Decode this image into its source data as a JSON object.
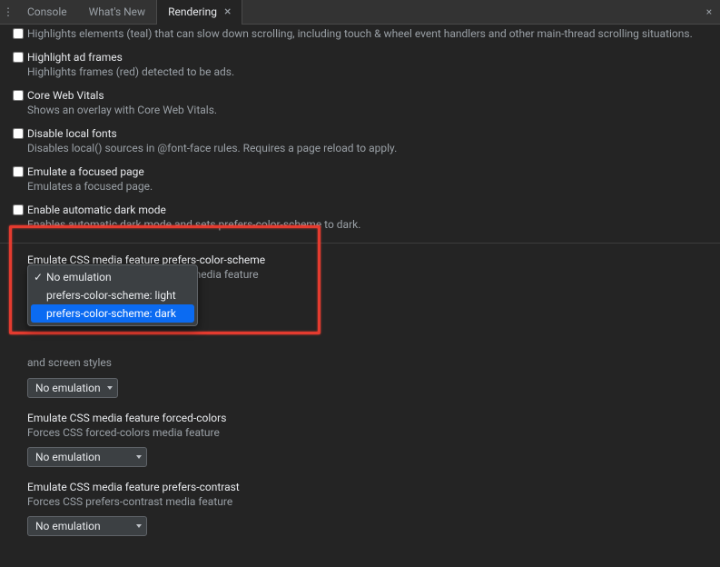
{
  "tabs": {
    "console": "Console",
    "whatsnew": "What's New",
    "rendering": "Rendering"
  },
  "rows": {
    "r0": {
      "tail": "Highlights elements (teal) that can slow down scrolling, including touch & wheel event handlers and other main-thread scrolling situations."
    },
    "r1": {
      "t": "Highlight ad frames",
      "d": "Highlights frames (red) detected to be ads."
    },
    "r2": {
      "t": "Core Web Vitals",
      "d": "Shows an overlay with Core Web Vitals."
    },
    "r3": {
      "t": "Disable local fonts",
      "d": "Disables local() sources in @font-face rules. Requires a page reload to apply."
    },
    "r4": {
      "t": "Emulate a focused page",
      "d": "Emulates a focused page."
    },
    "r5": {
      "t": "Enable automatic dark mode",
      "d": "Enables automatic dark mode and sets prefers-color-scheme to dark."
    }
  },
  "sections": {
    "s1": {
      "t": "Emulate CSS media feature prefers-color-scheme",
      "d": "Forces CSS prefers-color-scheme media feature"
    },
    "s2_trail": "and screen styles",
    "s2_sel": "No emulation",
    "s3": {
      "t": "Emulate CSS media feature forced-colors",
      "d": "Forces CSS forced-colors media feature",
      "sel": "No emulation"
    },
    "s4": {
      "t": "Emulate CSS media feature prefers-contrast",
      "d": "Forces CSS prefers-contrast media feature",
      "sel": "No emulation"
    }
  },
  "popup": {
    "o0": "No emulation",
    "o1": "prefers-color-scheme: light",
    "o2": "prefers-color-scheme: dark"
  }
}
